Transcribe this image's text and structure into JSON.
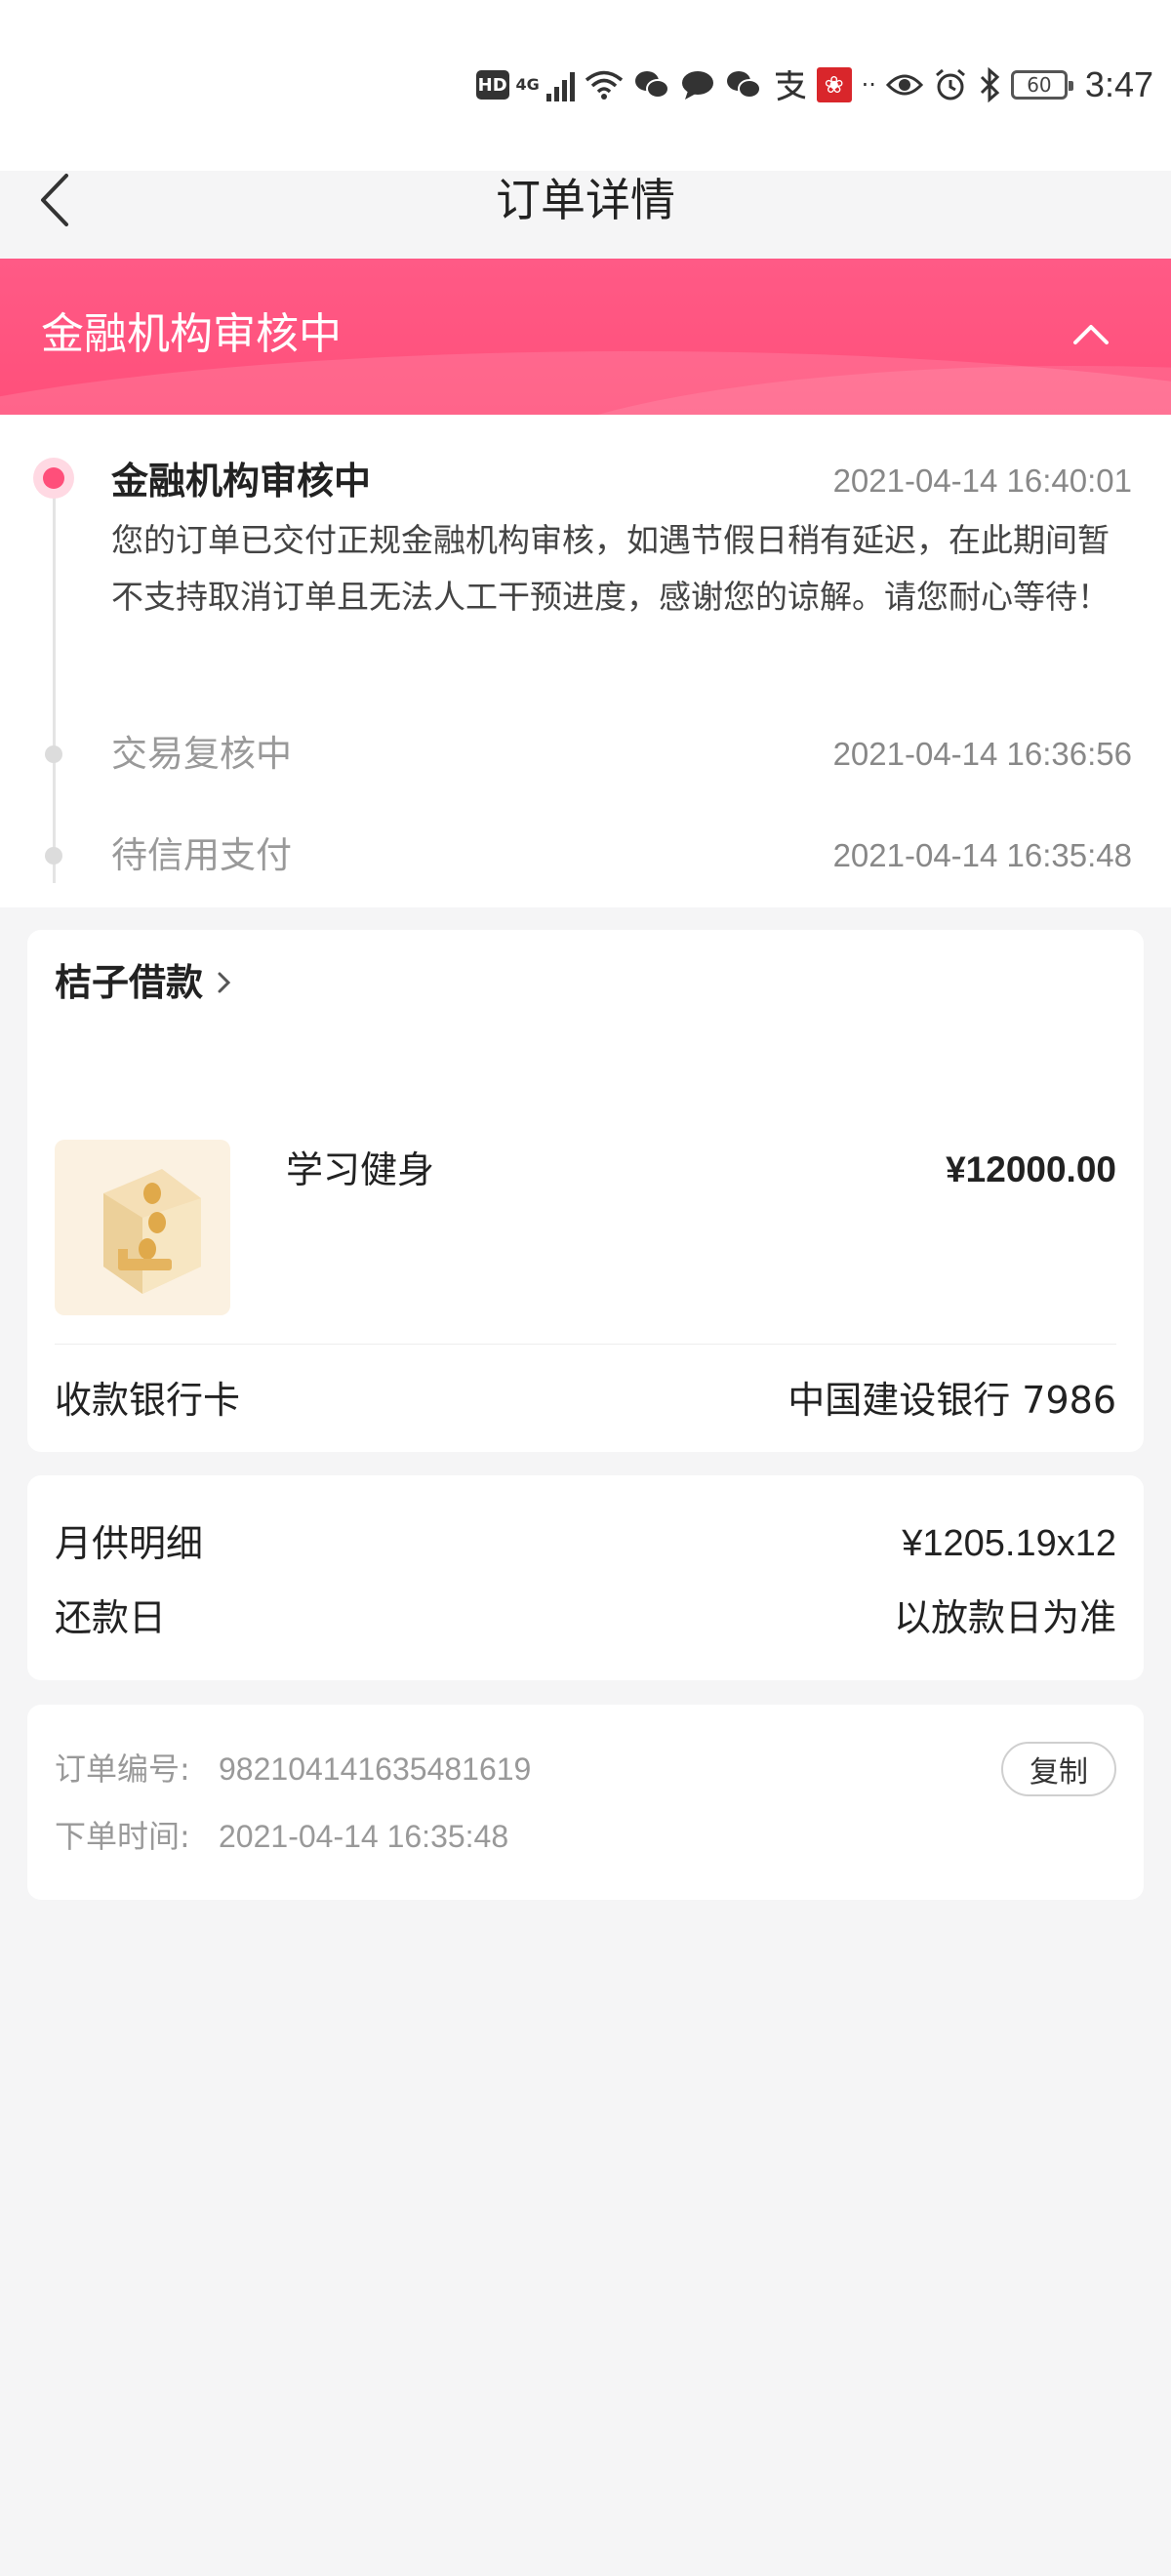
{
  "status_bar": {
    "hd": "HD",
    "network": "4G",
    "battery": "60",
    "time": "3:47"
  },
  "header": {
    "title": "订单详情"
  },
  "banner": {
    "title": "金融机构审核中"
  },
  "timeline": [
    {
      "title": "金融机构审核中",
      "time": "2021-04-14 16:40:01",
      "description": "您的订单已交付正规金融机构审核，如遇节假日稍有延迟，在此期间暂不支持取消订单且无法人工干预进度，感谢您的谅解。请您耐心等待！"
    },
    {
      "title": "交易复核中",
      "time": "2021-04-14 16:36:56"
    },
    {
      "title": "待信用支付",
      "time": "2021-04-14 16:35:48"
    }
  ],
  "order": {
    "merchant": "桔子借款",
    "product_name": "学习健身",
    "price": "¥12000.00",
    "bank_label": "收款银行卡",
    "bank_value": "中国建设银行 7986"
  },
  "repayment": {
    "monthly_label": "月供明细",
    "monthly_value": "¥1205.19x12",
    "day_label": "还款日",
    "day_value": "以放款日为准"
  },
  "info": {
    "order_no_label": "订单编号:",
    "order_no": "982104141635481619",
    "copy_label": "复制",
    "order_time_label": "下单时间:",
    "order_time": "2021-04-14 16:35:48"
  },
  "colors": {
    "accent": "#ff4f7a",
    "background": "#f5f5f6"
  }
}
